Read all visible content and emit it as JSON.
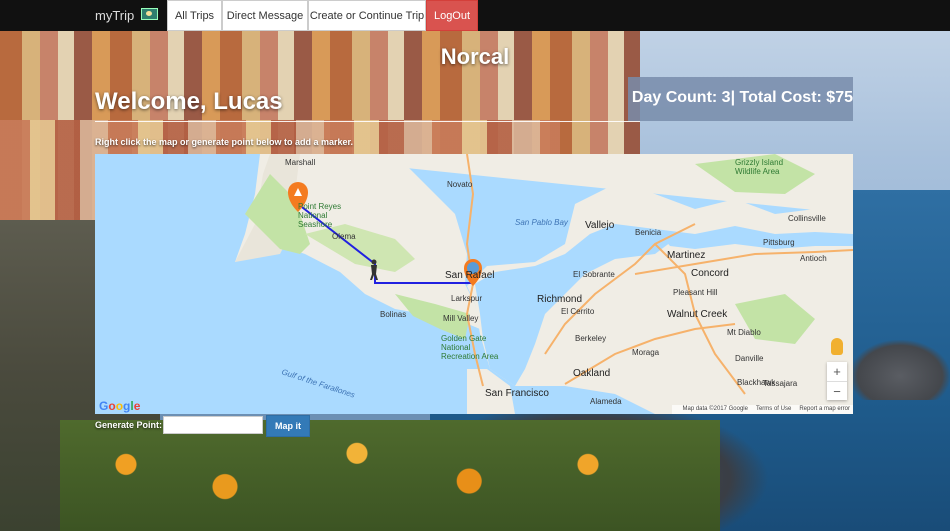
{
  "navbar": {
    "brand": "myTrip",
    "items": [
      "All Trips",
      "Direct Message",
      "Create or Continue Trip"
    ],
    "logout": "LogOut"
  },
  "trip": {
    "title": "Norcal",
    "welcome": "Welcome, Lucas",
    "stats": "Day Count: 3| Total Cost: $75",
    "instructions": "Right click the map or generate point below to add a marker."
  },
  "map": {
    "places": {
      "marshall": "Marshall",
      "point_reyes": "Point Reyes National Seashore",
      "olema": "Olema",
      "bolinas": "Bolinas",
      "mill_valley": "Mill Valley",
      "larkspur": "Larkspur",
      "san_rafael": "San Rafael",
      "novato": "Novato",
      "san_pablo_bay": "San Pablo Bay",
      "vallejo": "Vallejo",
      "benicia": "Benicia",
      "martinez": "Martinez",
      "pittsburg": "Pittsburg",
      "antioch": "Antioch",
      "concord": "Concord",
      "pleasant_hill": "Pleasant Hill",
      "walnut_creek": "Walnut Creek",
      "mt_diablo": "Mt Diablo",
      "danville": "Danville",
      "oakland": "Oakland",
      "berkeley": "Berkeley",
      "richmond": "Richmond",
      "el_cerrito": "El Cerrito",
      "el_sobrante": "El Sobrante",
      "san_francisco": "San Francisco",
      "alameda": "Alameda",
      "moraga": "Moraga",
      "tassajara": "Tassajara",
      "blackhawk": "Blackhawk",
      "collinsville": "Collinsville",
      "ggnra": "Golden Gate National Recreation Area",
      "gulf": "Gulf of the Farallones",
      "grizzly": "Grizzly Island Wildlife Area"
    },
    "logo": [
      "G",
      "o",
      "o",
      "g",
      "l",
      "e"
    ],
    "attribution": [
      "Map data ©2017 Google",
      "Terms of Use",
      "Report a map error"
    ],
    "zoom_in": "+",
    "zoom_out": "−"
  },
  "generate": {
    "label": "Generate Point:",
    "value": "",
    "button": "Map it"
  },
  "colors": {
    "route": "#2121e0",
    "marker": "#f47b20",
    "water": "#aadaff",
    "land": "#f0ede5",
    "park": "#c3e3a6",
    "logout": "#d9534f",
    "button": "#337ab7"
  },
  "icons": {
    "flag": "flag-icon",
    "marker_start": "campsite-marker-icon",
    "marker_end": "camera-marker-icon",
    "hiker": "hiker-icon",
    "pegman": "pegman-icon"
  }
}
